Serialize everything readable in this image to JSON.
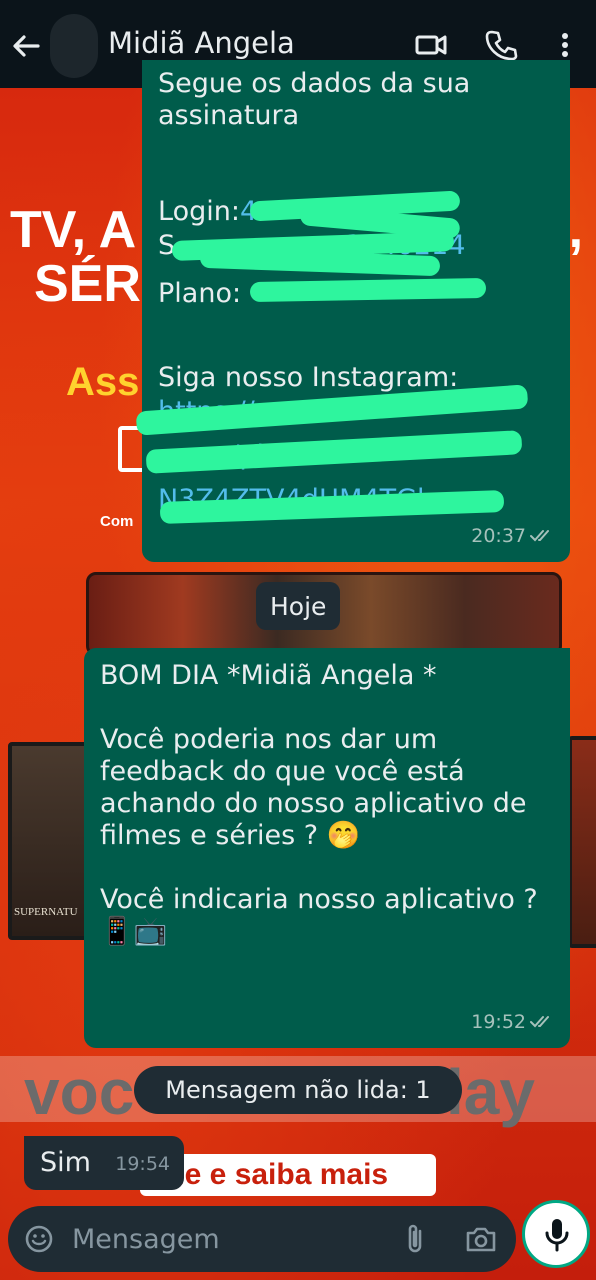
{
  "header": {
    "title": "Midiã Angela",
    "icons": [
      "back-arrow-icon",
      "video-call-icon",
      "phone-icon",
      "more-vertical-icon"
    ]
  },
  "wallpaper": {
    "line1a": "TV, A",
    "line1b": "S,",
    "line2": "SÉR",
    "yellow": "Ass",
    "small": "Com",
    "series_title": "SUPERNATU",
    "gray_left": "voc",
    "gray_right": "lay",
    "pill": "que e saiba mais"
  },
  "messages": [
    {
      "direction": "out",
      "lines_top": "Segue os dados da sua\nassinatura",
      "login_label": "Login:",
      "login_value_visible": "4",
      "password_visible": "S",
      "password_value_visible": "3040214",
      "plan_label": "Plano:",
      "instagram_label": "Siga nosso Instagram:",
      "link_line1": "https://",
      "link_line2": ".com/pl",
      "link_line3": "N3Z4ZTV4dHM4TGlx",
      "time": "20:37"
    },
    {
      "direction": "out",
      "text": "BOM DIA *Midiã Angela *\n\nVocê poderia nos dar um feedback do que você está achando do nosso aplicativo de filmes e séries ? 🤭\n\nVocê indicaria nosso aplicativo ?\n📱📺",
      "time": "19:52"
    },
    {
      "direction": "in",
      "text": "Sim",
      "time": "19:54"
    }
  ],
  "date_separator": "Hoje",
  "unread_banner": "Mensagem não lida: 1",
  "composer": {
    "placeholder": "Mensagem",
    "icons": [
      "emoji-icon",
      "attach-icon",
      "camera-icon",
      "mic-icon"
    ]
  },
  "colors": {
    "header_bg": "#0b141a",
    "out_bubble": "#005c4b",
    "in_bubble": "#1f2c34",
    "scribble": "#2ef59e",
    "accent": "#00a884"
  }
}
